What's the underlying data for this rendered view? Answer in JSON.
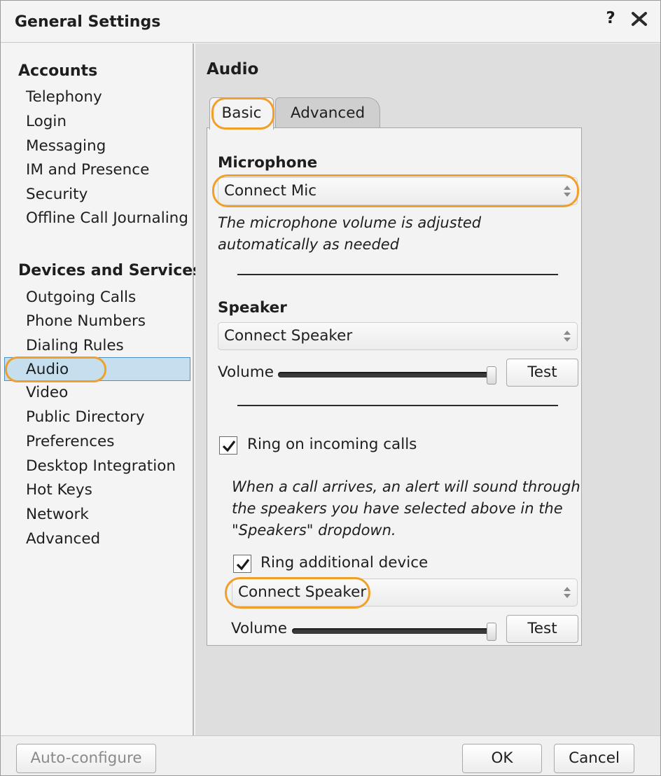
{
  "window": {
    "title": "General Settings",
    "help_symbol": "?"
  },
  "sidebar": {
    "groups": [
      {
        "title": "Accounts",
        "items": [
          "Telephony",
          "Login",
          "Messaging",
          "IM and Presence",
          "Security",
          "Offline Call Journaling"
        ]
      },
      {
        "title": "Devices and Services",
        "items": [
          "Outgoing Calls",
          "Phone Numbers",
          "Dialing Rules",
          "Audio",
          "Video",
          "Public Directory",
          "Preferences",
          "Desktop Integration",
          "Hot Keys",
          "Network",
          "Advanced"
        ]
      }
    ],
    "selected": "Audio"
  },
  "main": {
    "title": "Audio",
    "tabs": [
      {
        "label": "Basic",
        "active": true
      },
      {
        "label": "Advanced",
        "active": false
      }
    ],
    "microphone": {
      "label": "Microphone",
      "selected": "Connect Mic",
      "note": "The microphone volume is adjusted automatically as needed"
    },
    "speaker": {
      "label": "Speaker",
      "selected": "Connect Speaker",
      "volume_label": "Volume",
      "volume_level": 1.0,
      "test_label": "Test"
    },
    "ring_incoming": {
      "label": "Ring on incoming calls",
      "checked": true,
      "note_line1": "When a call arrives, an alert will sound through",
      "note_line2": "the speakers you have selected above in the",
      "note_line3": "\"Speakers\" dropdown."
    },
    "ring_additional": {
      "label": "Ring additional device",
      "checked": true,
      "selected": "Connect Speaker",
      "volume_label": "Volume",
      "volume_level": 1.0,
      "test_label": "Test"
    }
  },
  "footer": {
    "auto_configure_label": "Auto-configure",
    "ok_label": "OK",
    "cancel_label": "Cancel"
  },
  "colors": {
    "highlight": "#f0a02a",
    "selection_bg": "#c5dfee",
    "selection_border": "#4a90c8"
  }
}
